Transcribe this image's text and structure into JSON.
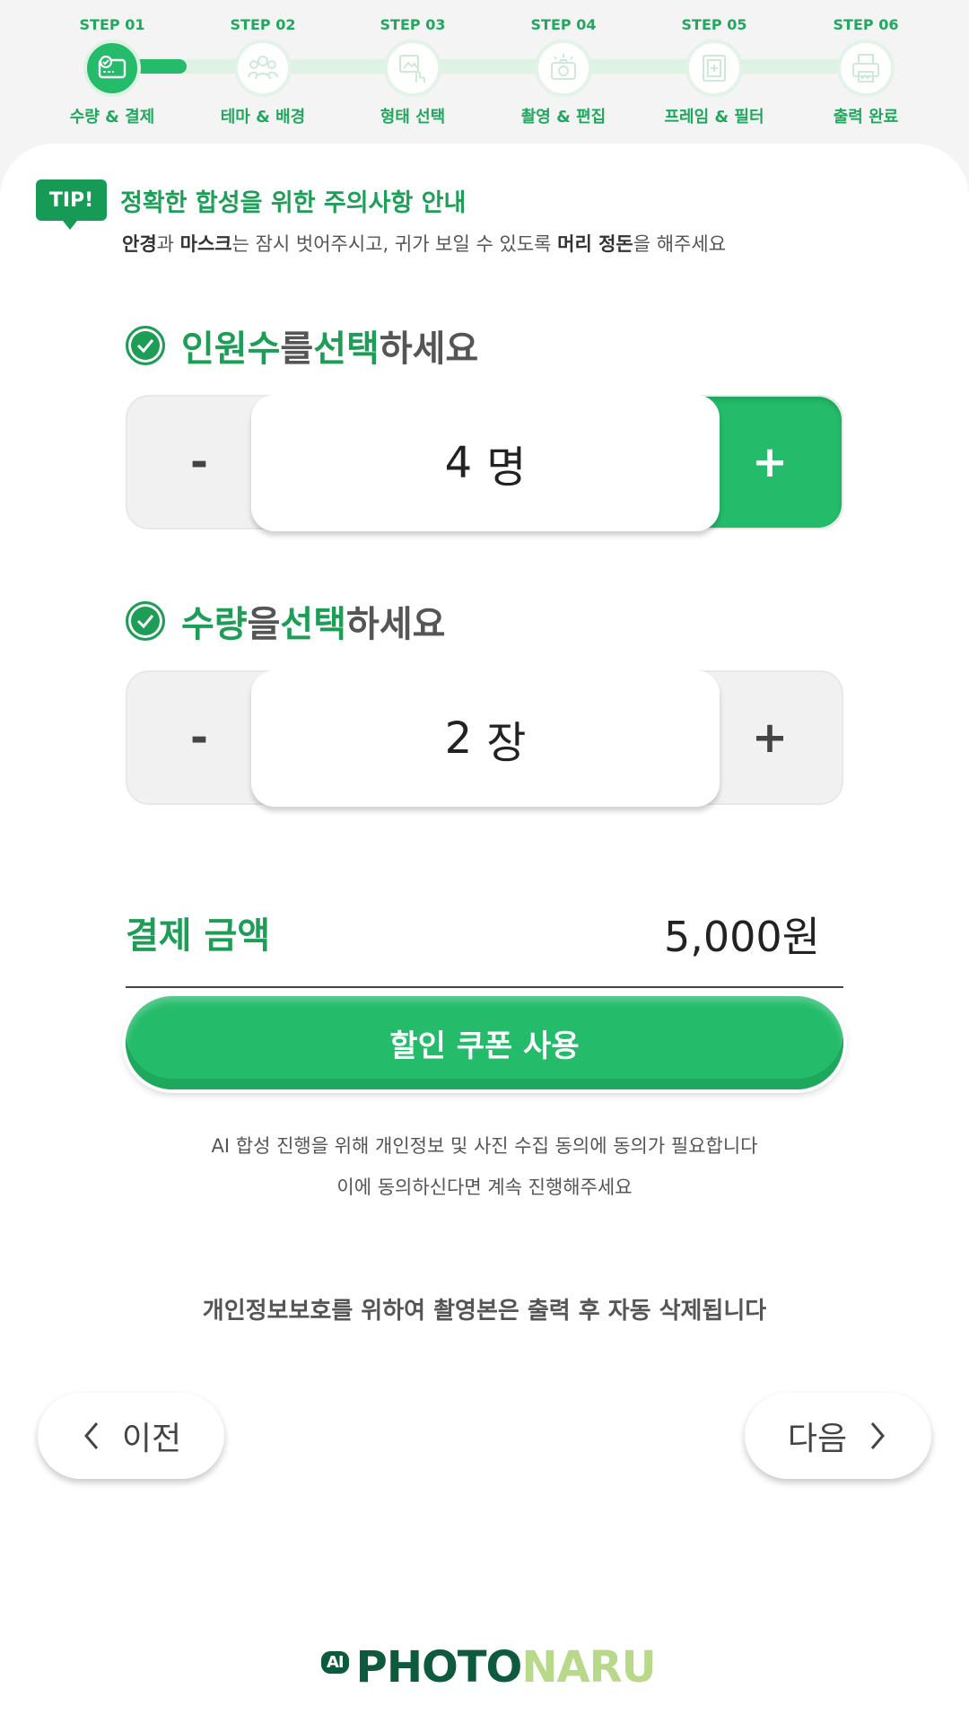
{
  "stepper": {
    "steps": [
      {
        "num": "STEP 01",
        "label": "수량 & 결제",
        "icon": "card-icon",
        "active": true
      },
      {
        "num": "STEP 02",
        "label": "테마 & 배경",
        "icon": "group-icon",
        "active": false
      },
      {
        "num": "STEP 03",
        "label": "형태 선택",
        "icon": "touch-icon",
        "active": false
      },
      {
        "num": "STEP 04",
        "label": "촬영 & 편집",
        "icon": "camera-icon",
        "active": false
      },
      {
        "num": "STEP 05",
        "label": "프레임 & 필터",
        "icon": "frame-icon",
        "active": false
      },
      {
        "num": "STEP 06",
        "label": "출력 완료",
        "icon": "printer-icon",
        "active": false
      }
    ],
    "progress": 0.1
  },
  "tip": {
    "badge": "TIP!",
    "title": "정확한 합성을 위한 주의사항 안내",
    "desc_parts": [
      "안경",
      "과 ",
      "마스크",
      "는 잠시 벗어주시고, 귀가 보일 수 있도록 ",
      "머리 정돈",
      "을 해주세요"
    ]
  },
  "people": {
    "heading_parts": [
      "인원수",
      "를 ",
      "선택",
      "하세요"
    ],
    "minus": "-",
    "plus": "+",
    "value": "4",
    "unit": "명"
  },
  "quantity": {
    "heading_parts": [
      "수량",
      "을 ",
      "선택",
      "하세요"
    ],
    "minus": "-",
    "plus": "+",
    "value": "2",
    "unit": "장"
  },
  "payment": {
    "label": "결제 금액",
    "amount": "5,000원"
  },
  "coupon_button": "할인 쿠폰 사용",
  "consent": {
    "line1": "AI 합성 진행을 위해 개인정보 및 사진 수집 동의에 동의가 필요합니다",
    "line2": "이에 동의하신다면 계속 진행해주세요"
  },
  "privacy_notice": "개인정보보호를 위하여 촬영본은 출력 후 자동 삭제됩니다",
  "nav": {
    "prev": "이전",
    "next": "다음"
  },
  "logo": {
    "ai": "AI",
    "photo": "PHOTO",
    "naru": "NARU"
  },
  "colors": {
    "accent": "#24bb6a",
    "accent_dark": "#1e9d57",
    "logo_dark": "#0e5a3d",
    "logo_light": "#b9d98a"
  }
}
